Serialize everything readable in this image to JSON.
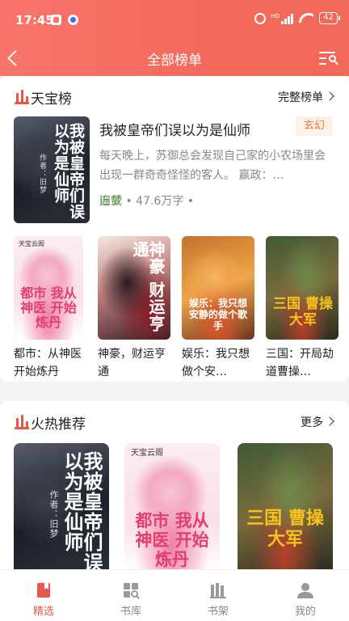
{
  "status_bar": {
    "time": "17:45",
    "network": "HD",
    "battery": "42"
  },
  "header": {
    "title": "全部榜单"
  },
  "section1": {
    "title": "天宝榜",
    "more": "完整榜单",
    "featured": {
      "title": "我被皇帝们误以为是仙师",
      "tag": "玄幻",
      "description": "每天晚上，苏御总会发现自己家的小农场里会出现一群奇奇怪怪的客人。 赢政：…",
      "author": "旧梦",
      "word_count": "47.6万字",
      "status": "连载",
      "cover_text": "我被皇帝们误以为是仙师",
      "cover_author": "作者：旧梦"
    },
    "books": [
      {
        "title": "都市：从神医开始炼丹",
        "cover_text": "都市 我从神医 开始炼丹",
        "publisher": "天宝云阁"
      },
      {
        "title": "神豪，财运亨通",
        "cover_text": "神豪 财运亨通"
      },
      {
        "title": "娱乐：我只想做个安…",
        "cover_text": "娱乐：我只想安静的做个歌手"
      },
      {
        "title": "三国：开局劫道曹操…",
        "cover_text": "三国 曹操大军"
      }
    ]
  },
  "section2": {
    "title": "火热推荐",
    "more": "更多",
    "books": [
      {
        "cover_text": "我被皇帝们误以为是仙师",
        "cover_author": "作者：旧梦"
      },
      {
        "cover_text": "都市 我从神医 开始炼丹",
        "publisher": "天宝云阁"
      },
      {
        "cover_text": "三国 曹操大军"
      }
    ]
  },
  "tabbar": {
    "items": [
      {
        "label": "精选",
        "icon": "bookmark-book-icon",
        "active": true
      },
      {
        "label": "书库",
        "icon": "grid-search-icon",
        "active": false
      },
      {
        "label": "书架",
        "icon": "bookshelf-icon",
        "active": false
      },
      {
        "label": "我的",
        "icon": "person-icon",
        "active": false
      }
    ],
    "active_color": "#e8584a"
  },
  "colors": {
    "header": "#f36a5c",
    "accent": "#e95548",
    "tag_text": "#e97a3a",
    "status_green": "#6aa84f"
  }
}
